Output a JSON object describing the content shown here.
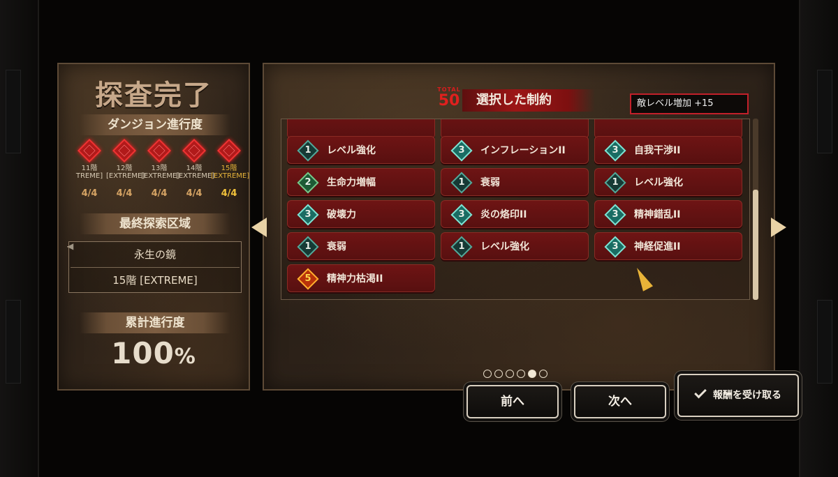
{
  "left_panel": {
    "title": "探査完了",
    "dungeon_progress_header": "ダンジョン進行度",
    "floors": [
      {
        "name": "11階",
        "difficulty": "TREME]",
        "progress": "4/4",
        "highlight": false
      },
      {
        "name": "12階",
        "difficulty": "[EXTREME]",
        "progress": "4/4",
        "highlight": false
      },
      {
        "name": "13階",
        "difficulty": "[EXTREME]",
        "progress": "4/4",
        "highlight": false
      },
      {
        "name": "14階",
        "difficulty": "[EXTREME]",
        "progress": "4/4",
        "highlight": false
      },
      {
        "name": "15階",
        "difficulty": "[EXTREME]",
        "progress": "4/4",
        "highlight": true
      }
    ],
    "final_area_header": "最終探索区域",
    "final_area_name": "永生の鏡",
    "final_area_floor": "15階 [EXTREME]",
    "total_progress_header": "累計進行度",
    "total_progress_value": "100",
    "total_progress_unit": "%"
  },
  "right_panel": {
    "total_label": "TOTAL",
    "total_value": "50",
    "title": "選択した制約",
    "enemy_level_text": "敵レベル増加 +15",
    "constraints": [
      {
        "level": "1",
        "name": "レベル強化",
        "tier": "dark"
      },
      {
        "level": "3",
        "name": "インフレーションII",
        "tier": "teal"
      },
      {
        "level": "3",
        "name": "自我干渉II",
        "tier": "teal"
      },
      {
        "level": "2",
        "name": "生命力増幅",
        "tier": "green"
      },
      {
        "level": "1",
        "name": "衰弱",
        "tier": "dark"
      },
      {
        "level": "1",
        "name": "レベル強化",
        "tier": "dark"
      },
      {
        "level": "3",
        "name": "破壊力",
        "tier": "teal"
      },
      {
        "level": "3",
        "name": "炎の烙印II",
        "tier": "teal"
      },
      {
        "level": "3",
        "name": "精神錯乱II",
        "tier": "teal"
      },
      {
        "level": "1",
        "name": "衰弱",
        "tier": "dark"
      },
      {
        "level": "1",
        "name": "レベル強化",
        "tier": "dark"
      },
      {
        "level": "3",
        "name": "神経促進II",
        "tier": "teal"
      },
      {
        "level": "5",
        "name": "精神力枯渇II",
        "tier": "gold"
      }
    ],
    "scroll_fraction": 0.4,
    "page_count": 6,
    "current_page": 5
  },
  "buttons": {
    "prev_label": "前へ",
    "next_label": "次へ",
    "reward_label": "報酬を受け取る"
  },
  "colors": {
    "accent_red": "#c3202a",
    "level_teal": "#7fe3d3",
    "level_gold": "#ffb02e",
    "highlight_gold": "#e8b53a"
  }
}
